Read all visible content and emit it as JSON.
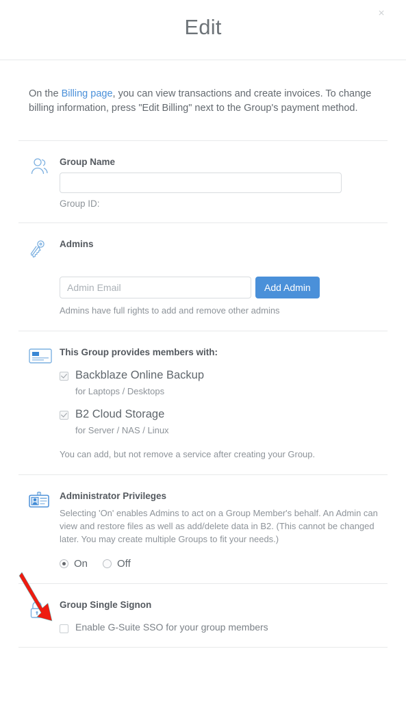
{
  "modal": {
    "title": "Edit",
    "close_label": "×",
    "intro": {
      "before_link": "On the ",
      "link_text": "Billing page",
      "after_link": ", you can view transactions and create invoices. To change billing information, press \"Edit Billing\" next to the Group's payment method."
    }
  },
  "group_name": {
    "icon": "group-people-icon",
    "label": "Group Name",
    "value": "",
    "placeholder": "",
    "group_id_label": "Group ID:"
  },
  "admins": {
    "icon": "keys-icon",
    "label": "Admins",
    "email_value": "",
    "email_placeholder": "Admin Email",
    "add_button": "Add Admin",
    "help": "Admins have full rights to add and remove other admins"
  },
  "services": {
    "icon": "backblaze-card-icon",
    "label": "This Group provides members with:",
    "items": [
      {
        "name": "Backblaze Online Backup",
        "sub": "for Laptops / Desktops",
        "checked": true
      },
      {
        "name": "B2 Cloud Storage",
        "sub": "for Server / NAS / Linux",
        "checked": true
      }
    ],
    "note": "You can add, but not remove a service after creating your Group."
  },
  "admin_privileges": {
    "icon": "id-badge-icon",
    "label": "Administrator Privileges",
    "description": "Selecting 'On' enables Admins to act on a Group Member's behalf. An Admin can view and restore files as well as add/delete data in B2. (This cannot be changed later. You may create multiple Groups to fit your needs.)",
    "options": [
      {
        "label": "On",
        "selected": true
      },
      {
        "label": "Off",
        "selected": false
      }
    ]
  },
  "single_signon": {
    "icon": "lock-icon",
    "label": "Group Single Signon",
    "checkbox_label": "Enable G-Suite SSO for your group members",
    "checked": false
  },
  "annotation": {
    "arrow": "red-arrow-pointing-to-group-single-signon",
    "color": "#ee1c11"
  },
  "colors": {
    "accent_blue": "#4a90d9",
    "link_blue": "#4a90d9",
    "icon_blue": "#7cb0e0",
    "divider": "#e7e9ea",
    "text": "#5f666c",
    "muted_text": "#8d9399"
  }
}
